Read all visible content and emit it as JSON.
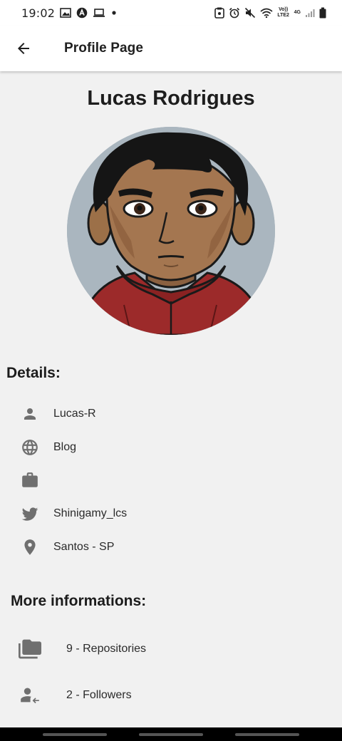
{
  "status_bar": {
    "time": "19:02",
    "left_icons": [
      "image-icon",
      "app-icon",
      "laptop-icon",
      "dot-icon"
    ],
    "right_icons": [
      "screenshot-icon",
      "alarm-icon",
      "mute-icon",
      "wifi-icon",
      "volte-icon",
      "signal-4g-icon",
      "signal-icon",
      "battery-icon"
    ],
    "volte_label": "Vo)) LTE2",
    "net_label": "4G"
  },
  "app_bar": {
    "title": "Profile Page",
    "back_icon": "arrow-back-icon"
  },
  "profile": {
    "name": "Lucas Rodrigues"
  },
  "details": {
    "title": "Details:",
    "items": [
      {
        "icon": "person-icon",
        "label": "Lucas-R"
      },
      {
        "icon": "globe-icon",
        "label": "Blog"
      },
      {
        "icon": "briefcase-icon",
        "label": ""
      },
      {
        "icon": "twitter-icon",
        "label": "Shinigamy_lcs"
      },
      {
        "icon": "location-pin-icon",
        "label": "Santos - SP"
      }
    ]
  },
  "more": {
    "title": "More informations:",
    "items": [
      {
        "icon": "folders-icon",
        "label": "9 - Repositories"
      },
      {
        "icon": "follower-icon",
        "label": "2 - Followers"
      }
    ]
  },
  "colors": {
    "background": "#f1f1f1",
    "app_bar": "#ffffff",
    "icon_gray": "#6f6f6f",
    "avatar_bg": "#aab6bf"
  }
}
